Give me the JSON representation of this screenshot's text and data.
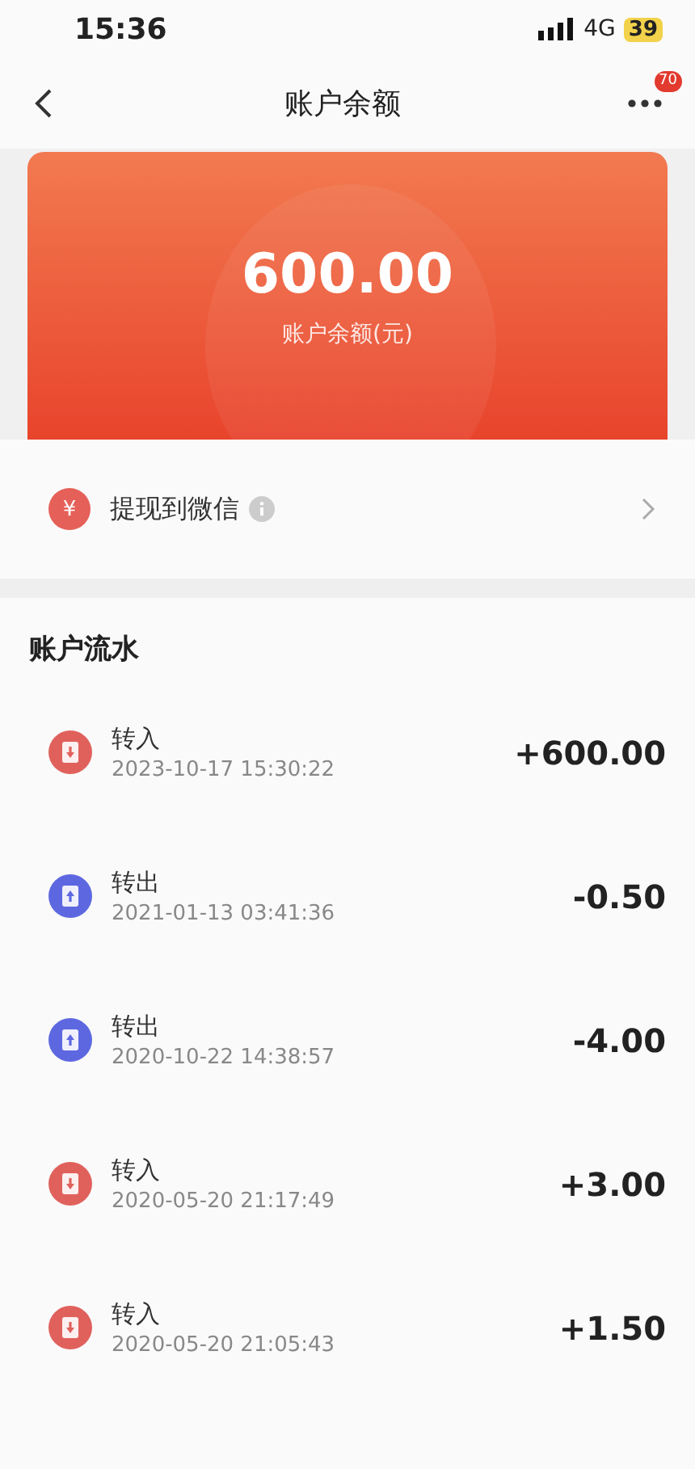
{
  "status_bar": {
    "time": "15:36",
    "network": "4G",
    "battery": "39"
  },
  "nav": {
    "title": "账户余额",
    "badge": "70"
  },
  "balance": {
    "amount": "600.00",
    "label": "账户余额(元)"
  },
  "withdraw": {
    "icon": "¥",
    "label": "提现到微信"
  },
  "section_title": "账户流水",
  "transactions": [
    {
      "kind": "in",
      "title": "转入",
      "time": "2023-10-17 15:30:22",
      "amount": "+600.00"
    },
    {
      "kind": "out",
      "title": "转出",
      "time": "2021-01-13 03:41:36",
      "amount": "-0.50"
    },
    {
      "kind": "out",
      "title": "转出",
      "time": "2020-10-22 14:38:57",
      "amount": "-4.00"
    },
    {
      "kind": "in",
      "title": "转入",
      "time": "2020-05-20 21:17:49",
      "amount": "+3.00"
    },
    {
      "kind": "in",
      "title": "转入",
      "time": "2020-05-20 21:05:43",
      "amount": "+1.50"
    }
  ]
}
